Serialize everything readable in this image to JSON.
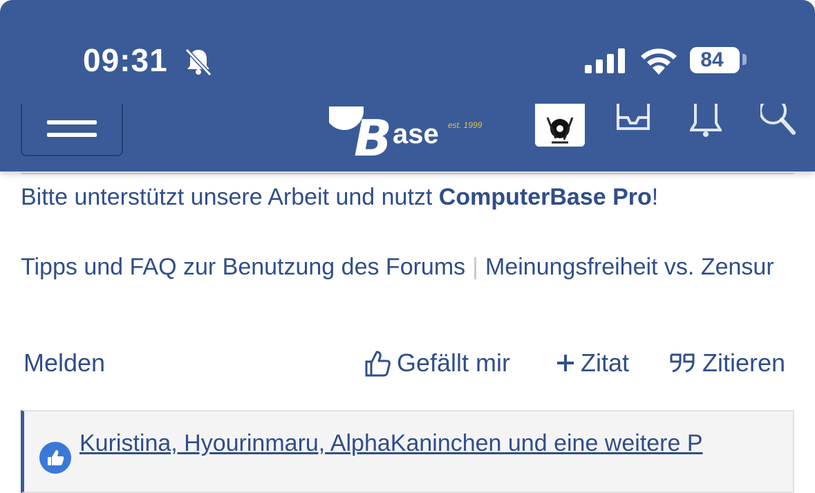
{
  "status_bar": {
    "time": "09:31",
    "battery": "84",
    "icons": [
      "bell-muted-icon",
      "cellular-signal-icon",
      "wifi-icon",
      "battery-icon"
    ]
  },
  "header": {
    "logo_text": "Base",
    "logo_est": "est. 1999",
    "icons": [
      "menu-icon",
      "avatar",
      "inbox-icon",
      "bell-icon",
      "search-icon"
    ]
  },
  "notice": {
    "before": "Bitte unterstützt unsere Arbeit und nutzt ",
    "bold": "ComputerBase Pro",
    "after": "!"
  },
  "links": {
    "faq": "Tipps und FAQ zur Benutzung des Forums",
    "separator": "|",
    "meinungsfreiheit": "Meinungsfreiheit vs. Zensur"
  },
  "actions": {
    "report": "Melden",
    "like": "Gefällt mir",
    "quote_add": "Zitat",
    "quote": "Zitieren"
  },
  "reactions": {
    "text": "Kuristina, Hyourinmaru, AlphaKaninchen und eine weitere P"
  },
  "colors": {
    "brand": "#3a5b98",
    "link": "#2f4e8a",
    "like_badge": "#3a79d9"
  }
}
